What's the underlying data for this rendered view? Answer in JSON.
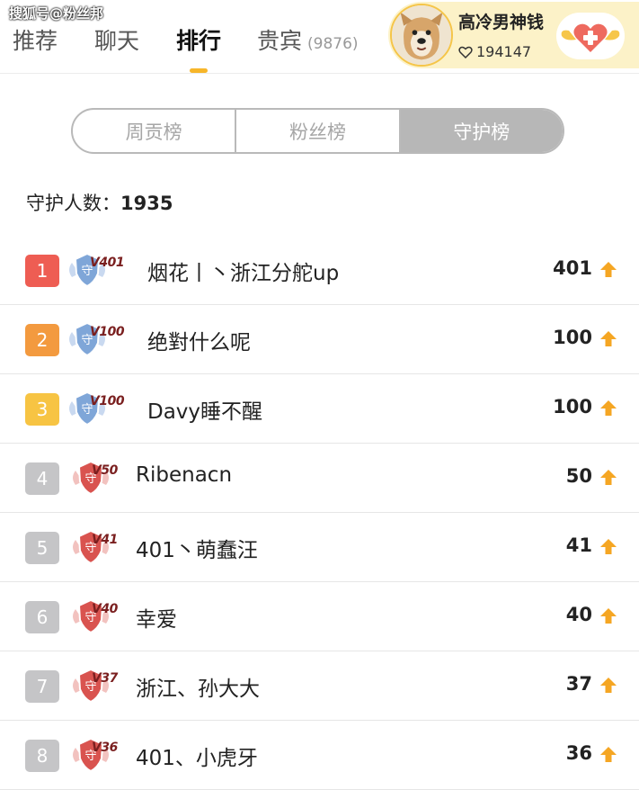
{
  "watermark": "搜狐号@粉丝邦",
  "tabs": [
    {
      "label": "推荐"
    },
    {
      "label": "聊天"
    },
    {
      "label": "排行"
    },
    {
      "label": "贵宾",
      "count": "(9876)"
    }
  ],
  "user": {
    "name": "高冷男神钱",
    "likes": "194147"
  },
  "segments": [
    {
      "label": "周贡榜",
      "active": false
    },
    {
      "label": "粉丝榜",
      "active": false
    },
    {
      "label": "守护榜",
      "active": true
    }
  ],
  "guard": {
    "label": "守护人数：",
    "count": "1935"
  },
  "colors": {
    "accent": "#f7b62a",
    "rank1": "#ee5d53",
    "rank2": "#f39a3f",
    "rank3": "#f7c443",
    "rank_other": "#c5c5c7",
    "badge_blue": "#7fa6d8",
    "badge_red": "#d9534f",
    "up_arrow": "#f5a623"
  },
  "ranking": [
    {
      "rank": "1",
      "badge": "V401",
      "badge_style": "blue",
      "name": "烟花丨丶浙江分舵up",
      "score": "401"
    },
    {
      "rank": "2",
      "badge": "V100",
      "badge_style": "blue",
      "name": "绝對什么呢",
      "score": "100"
    },
    {
      "rank": "3",
      "badge": "V100",
      "badge_style": "blue",
      "name": "Davy睡不醒",
      "score": "100"
    },
    {
      "rank": "4",
      "badge": "V50",
      "badge_style": "red",
      "name": "Ribenacn",
      "score": "50"
    },
    {
      "rank": "5",
      "badge": "V41",
      "badge_style": "red",
      "name": "401丶萌蠢汪",
      "score": "41"
    },
    {
      "rank": "6",
      "badge": "V40",
      "badge_style": "red",
      "name": "幸爱",
      "score": "40"
    },
    {
      "rank": "7",
      "badge": "V37",
      "badge_style": "red",
      "name": "浙江、孙大大",
      "score": "37"
    },
    {
      "rank": "8",
      "badge": "V36",
      "badge_style": "red",
      "name": "401、小虎牙",
      "score": "36"
    }
  ]
}
